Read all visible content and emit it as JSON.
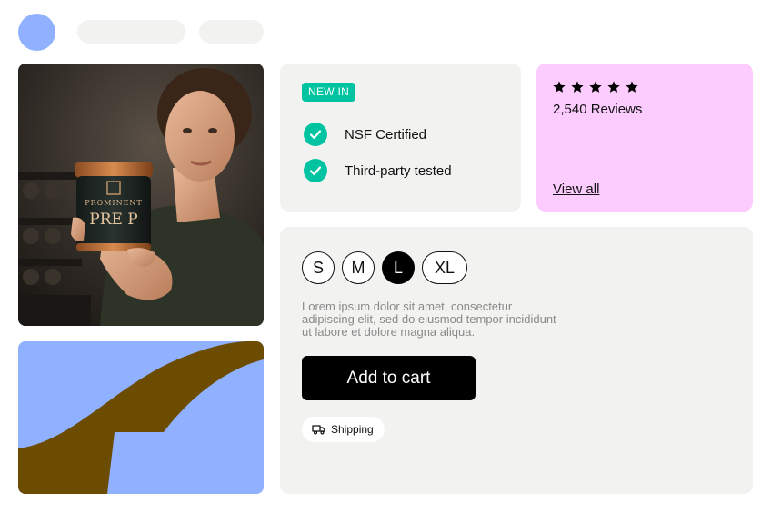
{
  "header": {
    "avatar_icon": "user-avatar",
    "placeholders": [
      "",
      ""
    ]
  },
  "product": {
    "jar_brand": "PROMINENT",
    "jar_name": "PRE P"
  },
  "features": {
    "badge": "NEW IN",
    "items": [
      {
        "icon": "check-icon",
        "label": "NSF Certified"
      },
      {
        "icon": "check-icon",
        "label": "Third-party tested"
      }
    ],
    "accent": "#00c4a1"
  },
  "reviews": {
    "stars": 5,
    "count_label": "2,540 Reviews",
    "view_all": "View all",
    "background": "#fdccff"
  },
  "purchase": {
    "sizes": [
      "S",
      "M",
      "L",
      "XL"
    ],
    "selected_size": "L",
    "description": "Lorem ipsum dolor sit amet, consectetur adipiscing elit, sed do eiusmod tempor incididunt ut labore et dolore magna aliqua.",
    "add_to_cart": "Add to cart",
    "shipping": "Shipping"
  },
  "colors": {
    "blue": "#8fb1ff",
    "brown": "#6b4c00",
    "panel": "#f2f2f0"
  }
}
